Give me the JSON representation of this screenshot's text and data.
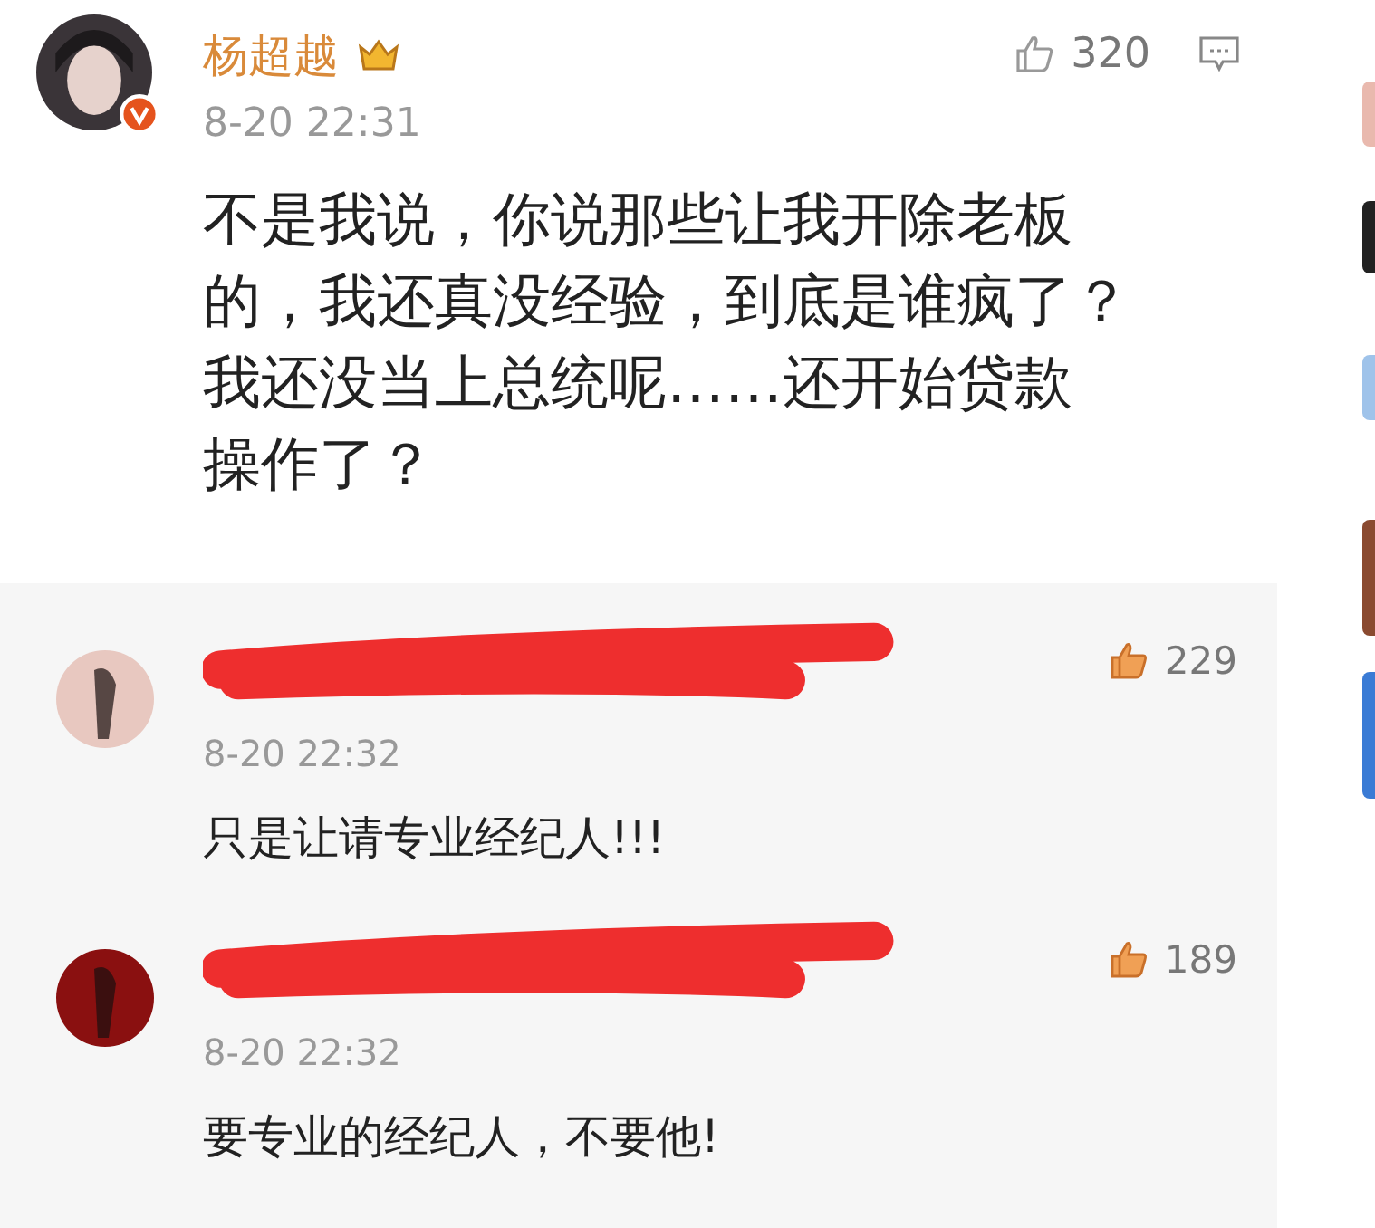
{
  "comment": {
    "author": "杨超越",
    "time": "8-20 22:31",
    "likes": "320",
    "liked": false,
    "body_lines": [
      "不是我说，你说那些让我开除老板",
      "的，我还真没经验，到底是谁疯了？",
      "我还没当上总统呢……还开始贷款",
      "操作了？"
    ]
  },
  "replies": [
    {
      "time": "8-20 22:32",
      "likes": "229",
      "liked": true,
      "text": "只是让请专业经纪人!!!"
    },
    {
      "time": "8-20 22:32",
      "likes": "189",
      "liked": true,
      "text": "要专业的经纪人，不要他!"
    }
  ]
}
